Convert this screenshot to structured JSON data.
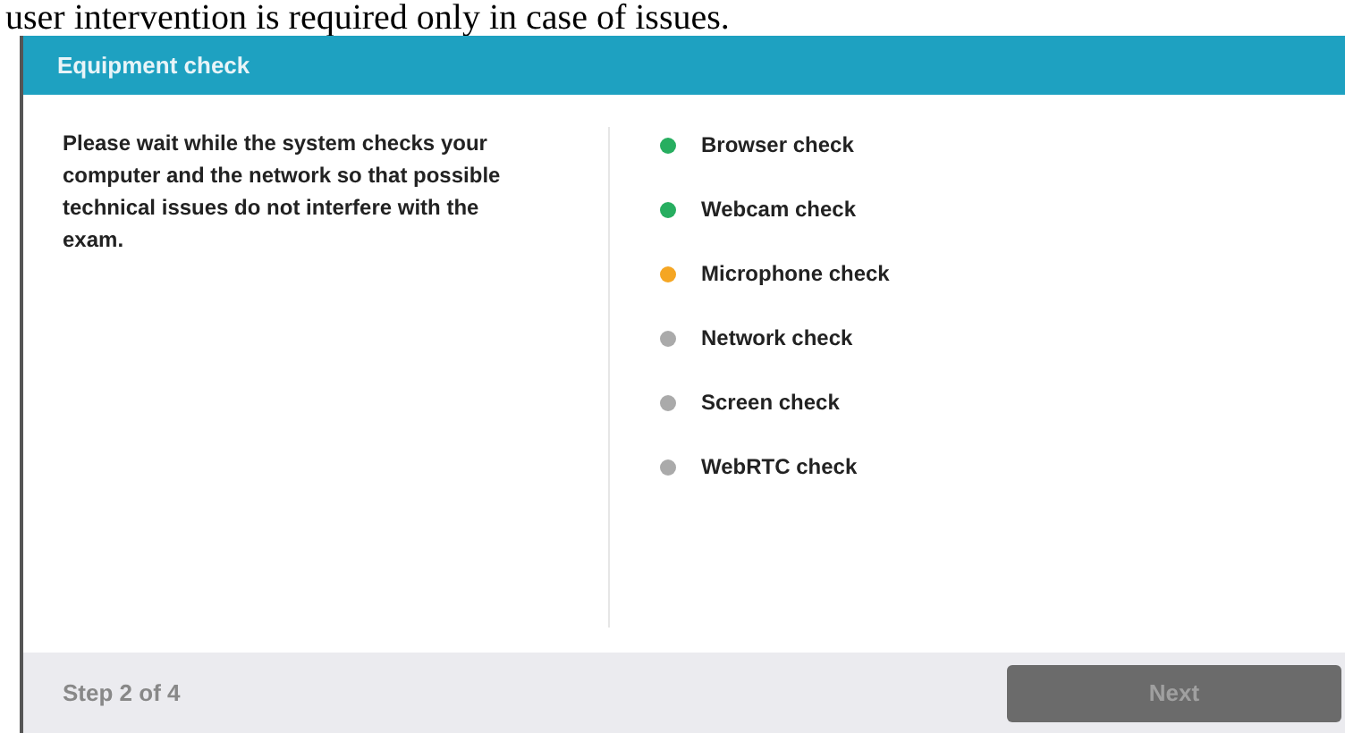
{
  "caption": "user intervention is required only in case of issues.",
  "dialog": {
    "title": "Equipment check",
    "description": "Please wait while the system checks your computer and the network so that possible technical issues do not interfere with the exam.",
    "checks": [
      {
        "label": "Browser check",
        "color": "#27ae60"
      },
      {
        "label": "Webcam check",
        "color": "#27ae60"
      },
      {
        "label": "Microphone check",
        "color": "#f5a623"
      },
      {
        "label": "Network check",
        "color": "#aaaaaa"
      },
      {
        "label": "Screen check",
        "color": "#aaaaaa"
      },
      {
        "label": "WebRTC check",
        "color": "#aaaaaa"
      }
    ],
    "step": "Step 2 of 4",
    "next_button": {
      "label": "Next",
      "disabled": true
    }
  }
}
